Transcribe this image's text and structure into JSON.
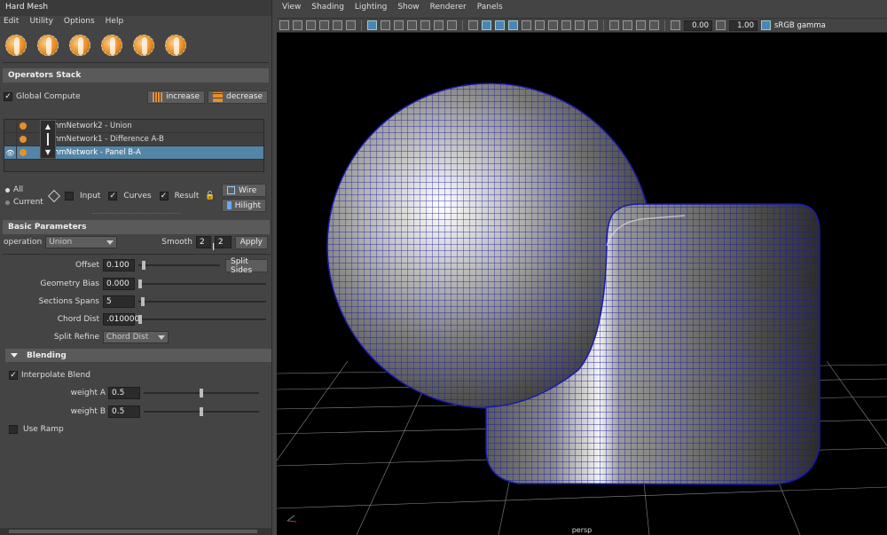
{
  "window": {
    "title": "Hard Mesh"
  },
  "menu": [
    "Edit",
    "Utility",
    "Options",
    "Help"
  ],
  "shelf_icons": [
    "hardmesh-icon-1",
    "hardmesh-icon-2",
    "hardmesh-icon-3",
    "hardmesh-icon-4",
    "hardmesh-icon-5",
    "hardmesh-icon-6"
  ],
  "operators": {
    "title": "Operators Stack",
    "global_compute": "Global Compute",
    "increase": "increase",
    "decrease": "decrease",
    "items": [
      {
        "name": "hmNetwork2 - Union",
        "selected": false
      },
      {
        "name": "hmNetwork1 - Difference A-B",
        "selected": false
      },
      {
        "name": "hmNetwork - Panel B-A",
        "selected": true
      }
    ],
    "radio_all": "All",
    "radio_current": "Current",
    "input": "Input",
    "curves": "Curves",
    "result": "Result",
    "wire": "Wire",
    "hilight": "Hilight"
  },
  "basic": {
    "title": "Basic Parameters",
    "operation_label": "operation",
    "operation_value": "Union",
    "smooth_label": "Smooth",
    "smooth_a": "2",
    "smooth_b": "2",
    "apply": "Apply",
    "offset_label": "Offset",
    "offset_value": "0.100",
    "split_sides": "Split Sides",
    "geometry_bias_label": "Geometry Bias",
    "geometry_bias_value": "0.000",
    "sections_spans_label": "Sections Spans",
    "sections_spans_value": "5",
    "chord_dist_label": "Chord Dist",
    "chord_dist_value": ".010000",
    "split_refine_label": "Split Refine",
    "split_refine_value": "Chord Dist"
  },
  "blending": {
    "title": "Blending",
    "interpolate_blend": "Interpolate Blend",
    "weight_a_label": "weight A",
    "weight_a_value": "0.5",
    "weight_b_label": "weight B",
    "weight_b_value": "0.5",
    "use_ramp": "Use Ramp"
  },
  "viewport": {
    "menu": [
      "View",
      "Shading",
      "Lighting",
      "Show",
      "Renderer",
      "Panels"
    ],
    "exposure": "0.00",
    "gamma": "1.00",
    "colorspace": "sRGB gamma",
    "camera": "persp"
  },
  "colors": {
    "accent_orange": "#e8902a",
    "selection_blue": "#5285a6",
    "wire_blue": "#1a1aa8"
  }
}
